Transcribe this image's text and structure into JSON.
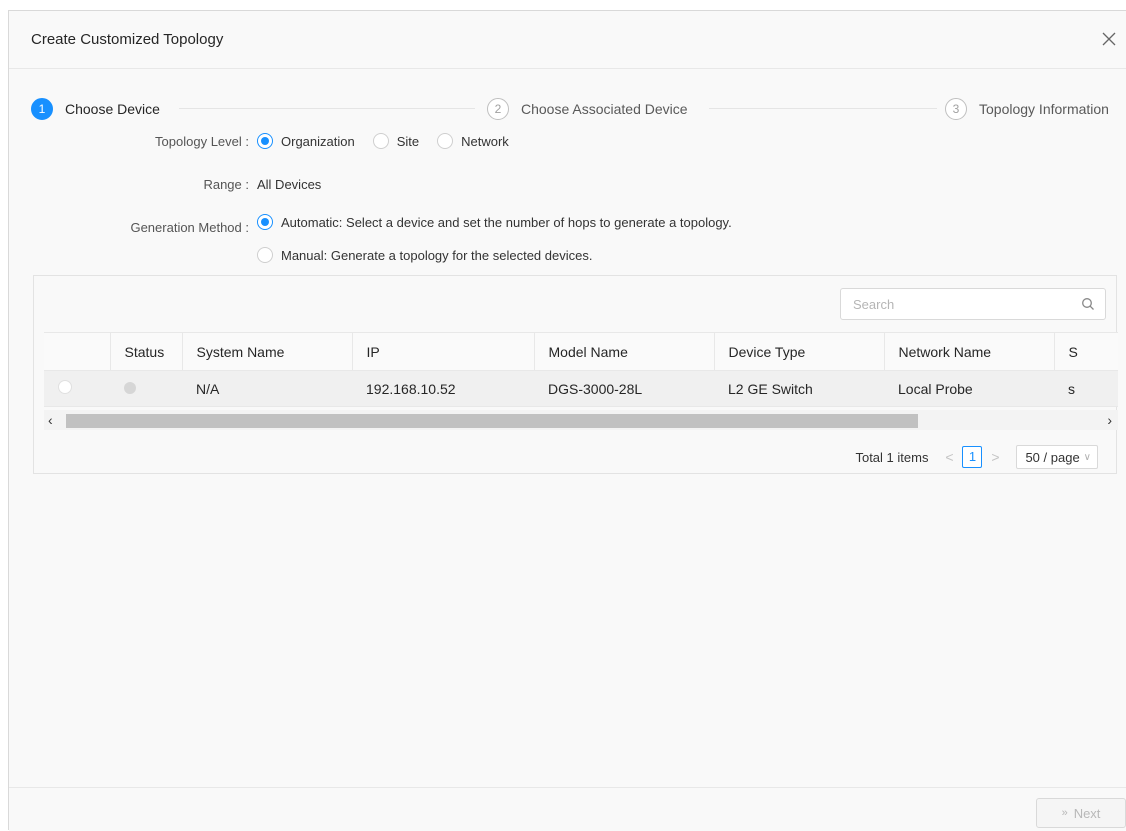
{
  "dialog": {
    "title": "Create Customized Topology",
    "close_icon": "close-icon"
  },
  "steps": [
    {
      "num": "1",
      "label": "Choose Device",
      "active": true
    },
    {
      "num": "2",
      "label": "Choose Associated Device",
      "active": false
    },
    {
      "num": "3",
      "label": "Topology Information",
      "active": false
    }
  ],
  "form": {
    "topology_level_label": "Topology Level :",
    "topology_options": [
      "Organization",
      "Site",
      "Network"
    ],
    "topology_selected": "Organization",
    "range_label": "Range :",
    "range_value": "All Devices",
    "generation_label": "Generation Method :",
    "generation_auto": "Automatic: Select a device and set the number of hops to generate a topology.",
    "generation_manual": "Manual: Generate a topology for the selected devices.",
    "generation_selected": "Automatic"
  },
  "search": {
    "placeholder": "Search",
    "icon": "search-icon"
  },
  "table": {
    "columns": [
      "",
      "Status",
      "System Name",
      "IP",
      "Model Name",
      "Device Type",
      "Network Name",
      "S"
    ],
    "rows": [
      {
        "select": "",
        "status": "",
        "system_name": "N/A",
        "ip": "192.168.10.52",
        "model_name": "DGS-3000-28L",
        "device_type": "L2 GE Switch",
        "network_name": "Local Probe",
        "extra": "s"
      }
    ]
  },
  "pagination": {
    "total": "Total 1 items",
    "prev": "<",
    "current": "1",
    "next": ">",
    "page_size": "50 / page"
  },
  "footer": {
    "next_label": "Next",
    "next_icon": "»"
  },
  "colors": {
    "accent": "#1890ff",
    "disabled": "#b8b8b8"
  }
}
